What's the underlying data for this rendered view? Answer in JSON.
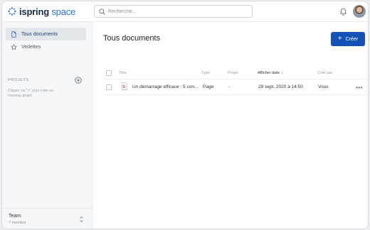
{
  "header": {
    "brand_primary": "ispring",
    "brand_secondary": "space",
    "search_placeholder": "Recherche...",
    "brand_color": "#2b6fd6"
  },
  "sidebar": {
    "items": [
      {
        "label": "Tous documents",
        "icon": "document-icon",
        "active": true
      },
      {
        "label": "Vedettes",
        "icon": "star-icon",
        "active": false
      }
    ],
    "projects_title": "PROJETS",
    "projects_hint": "Cliquez sur \"+\" pour créer un nouveau projet",
    "team_name": "Team",
    "team_count": "7 membre"
  },
  "main": {
    "title": "Tous documents",
    "create_label": "Créer",
    "accent_color": "#1552b8",
    "columns": [
      "Titre",
      "Type",
      "Projet",
      "Afficher date",
      "Créé par"
    ],
    "rows": [
      {
        "title": "Un démarrage efficace : 5 con...",
        "type": "Page",
        "project": "-",
        "date": "29 sept. 2020 à 14:50",
        "created_by": "Vous"
      }
    ]
  }
}
